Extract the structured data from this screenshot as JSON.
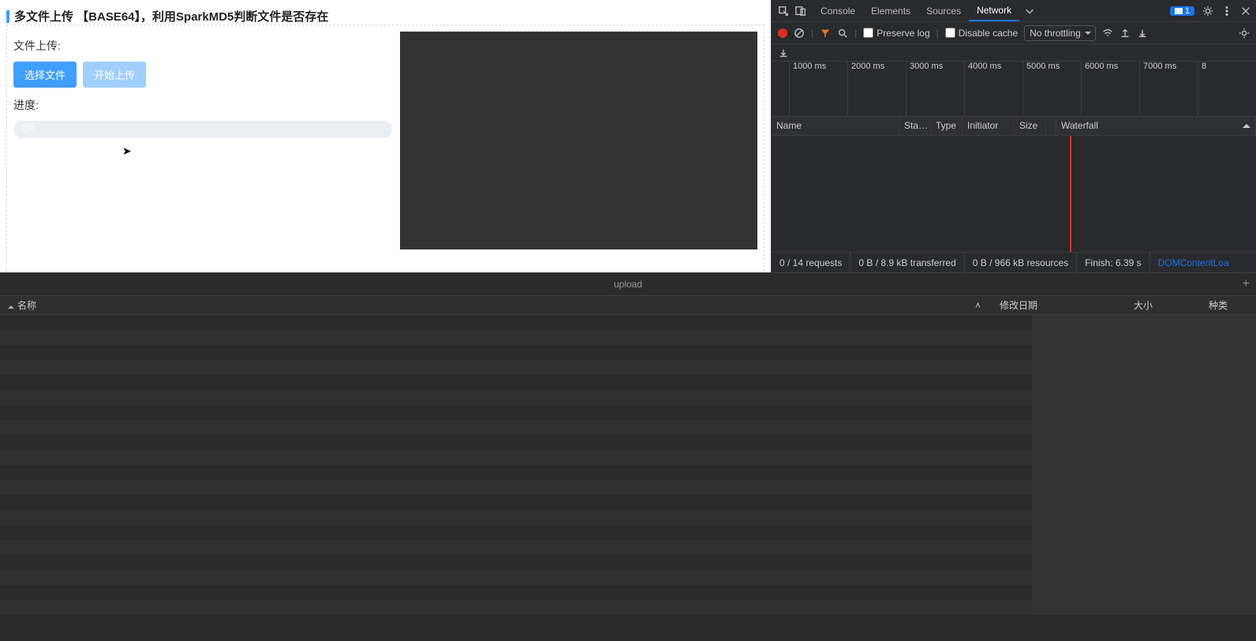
{
  "page": {
    "title": "多文件上传 【BASE64】，利用SparkMD5判断文件是否存在",
    "upload_label": "文件上传:",
    "choose_btn": "选择文件",
    "start_btn": "开始上传",
    "progress_label": "进度:",
    "progress_text": "0%"
  },
  "devtools": {
    "tabs": [
      "Console",
      "Elements",
      "Sources",
      "Network"
    ],
    "active_tab": "Network",
    "issue_badge": "1",
    "preserve_log": "Preserve log",
    "disable_cache": "Disable cache",
    "throttling": "No throttling",
    "timeline_ticks": [
      "1000 ms",
      "2000 ms",
      "3000 ms",
      "4000 ms",
      "5000 ms",
      "6000 ms",
      "7000 ms",
      "8"
    ],
    "columns": {
      "name": "Name",
      "status": "Sta…",
      "type": "Type",
      "initiator": "Initiator",
      "size": "Size",
      "waterfall": "Waterfall"
    },
    "status": {
      "requests": "0 / 14 requests",
      "transferred": "0 B / 8.9 kB transferred",
      "resources": "0 B / 966 kB resources",
      "finish": "Finish: 6.39 s",
      "domload": "DOMContentLoa"
    }
  },
  "filebrowser": {
    "title": "upload",
    "cols": {
      "name": "名称",
      "date": "修改日期",
      "size": "大小",
      "kind": "种类"
    }
  }
}
